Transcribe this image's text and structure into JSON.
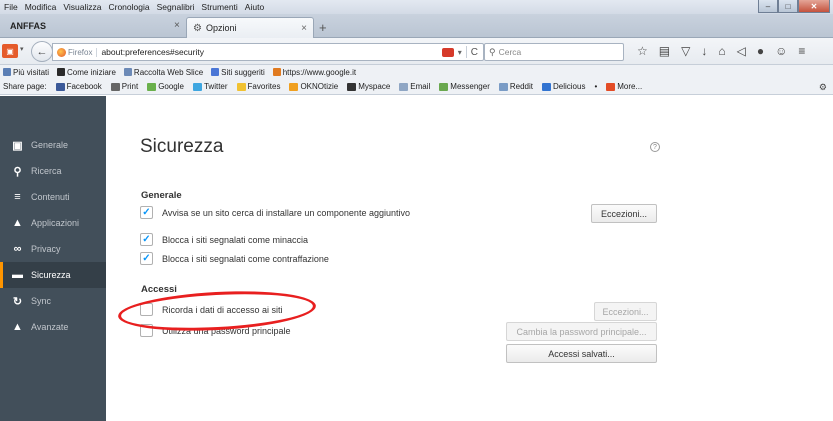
{
  "menubar": {
    "items": [
      "File",
      "Modifica",
      "Visualizza",
      "Cronologia",
      "Segnalibri",
      "Strumenti",
      "Aiuto"
    ]
  },
  "window_controls": {
    "minimize": "–",
    "maximize": "□",
    "close": "✕"
  },
  "tabs": {
    "group_title": "ANFFAS",
    "group_close": "×",
    "active_tab_label": "Opzioni",
    "tab_close": "×",
    "new_tab": "+"
  },
  "navbar": {
    "identity_label": "Firefox",
    "url": "about:preferences#security",
    "search_placeholder": "Cerca",
    "icons": [
      "star-icon",
      "reading-list-icon",
      "pocket-icon",
      "download-icon",
      "home-icon",
      "share-icon",
      "chat-icon",
      "extension-icon",
      "menu-icon"
    ]
  },
  "bookmarks_bar": {
    "items": [
      {
        "label": "Più visitati",
        "icon": "bookmarks-folder-icon",
        "color": "#5b7fb5"
      },
      {
        "label": "Come iniziare",
        "icon": "firefox-icon",
        "color": "#2a2a2a"
      },
      {
        "label": "Raccolta Web Slice",
        "icon": "webslice-icon",
        "color": "#6c8ab7"
      },
      {
        "label": "Siti suggeriti",
        "icon": "g-icon",
        "color": "#4a76d6"
      },
      {
        "label": "https://www.google.it",
        "icon": "bookmark-page-icon",
        "color": "#e07a1f"
      }
    ]
  },
  "share_bar": {
    "label": "Share page:",
    "items": [
      {
        "label": "Facebook",
        "icon": "facebook-icon",
        "color": "#3b5998"
      },
      {
        "label": "Print",
        "icon": "print-icon",
        "color": "#666666"
      },
      {
        "label": "Google",
        "icon": "google-icon",
        "color": "#6ab04c"
      },
      {
        "label": "Twitter",
        "icon": "twitter-icon",
        "color": "#3ea6e0"
      },
      {
        "label": "Favorites",
        "icon": "favorites-icon",
        "color": "#f1c232"
      },
      {
        "label": "OKNOtizie",
        "icon": "oknotizie-icon",
        "color": "#f0a020"
      },
      {
        "label": "Myspace",
        "icon": "myspace-icon",
        "color": "#333333"
      },
      {
        "label": "Email",
        "icon": "email-icon",
        "color": "#8fa6c4"
      },
      {
        "label": "Messenger",
        "icon": "messenger-icon",
        "color": "#6aa84f"
      },
      {
        "label": "Reddit",
        "icon": "reddit-icon",
        "color": "#7a9cc6"
      },
      {
        "label": "Delicious",
        "icon": "delicious-icon",
        "color": "#3274d1"
      },
      {
        "label": "•",
        "icon": "dot-icon",
        "color": "#888888"
      },
      {
        "label": "More...",
        "icon": "more-icon",
        "color": "#e34c26"
      }
    ]
  },
  "sidebar": {
    "items": [
      {
        "label": "Generale",
        "icon": "general-icon",
        "glyph": "▣"
      },
      {
        "label": "Ricerca",
        "icon": "search-icon",
        "glyph": "⚲"
      },
      {
        "label": "Contenuti",
        "icon": "content-icon",
        "glyph": "≡"
      },
      {
        "label": "Applicazioni",
        "icon": "applications-icon",
        "glyph": "▲"
      },
      {
        "label": "Privacy",
        "icon": "privacy-mask-icon",
        "glyph": "∞"
      },
      {
        "label": "Sicurezza",
        "icon": "security-lock-icon",
        "glyph": "▬"
      },
      {
        "label": "Sync",
        "icon": "sync-icon",
        "glyph": "↻"
      },
      {
        "label": "Avanzate",
        "icon": "advanced-icon",
        "glyph": "▲"
      }
    ],
    "active_index": 5,
    "accent": "#ff9500"
  },
  "content": {
    "title": "Sicurezza",
    "help_glyph": "?",
    "generale": {
      "heading": "Generale",
      "addon_warn": {
        "label": "Avvisa se un sito cerca di installare un componente aggiuntivo",
        "checked": true
      },
      "exceptions_button": "Eccezioni...",
      "block_attack": {
        "label": "Blocca i siti segnalati come minaccia",
        "checked": true
      },
      "block_forgery": {
        "label": "Blocca i siti segnalati come contraffazione",
        "checked": true
      }
    },
    "accessi": {
      "heading": "Accessi",
      "remember_logins": {
        "label": "Ricorda i dati di accesso ai siti",
        "checked": false
      },
      "exceptions_button": "Eccezioni...",
      "master_password": {
        "label": "Utilizza una password principale",
        "checked": false
      },
      "change_master_button": "Cambia la password principale...",
      "saved_logins_button": "Accessi salvati..."
    },
    "check_glyph": "✓",
    "check_color": "#0996f8",
    "annotation_color": "#e81f1f"
  }
}
